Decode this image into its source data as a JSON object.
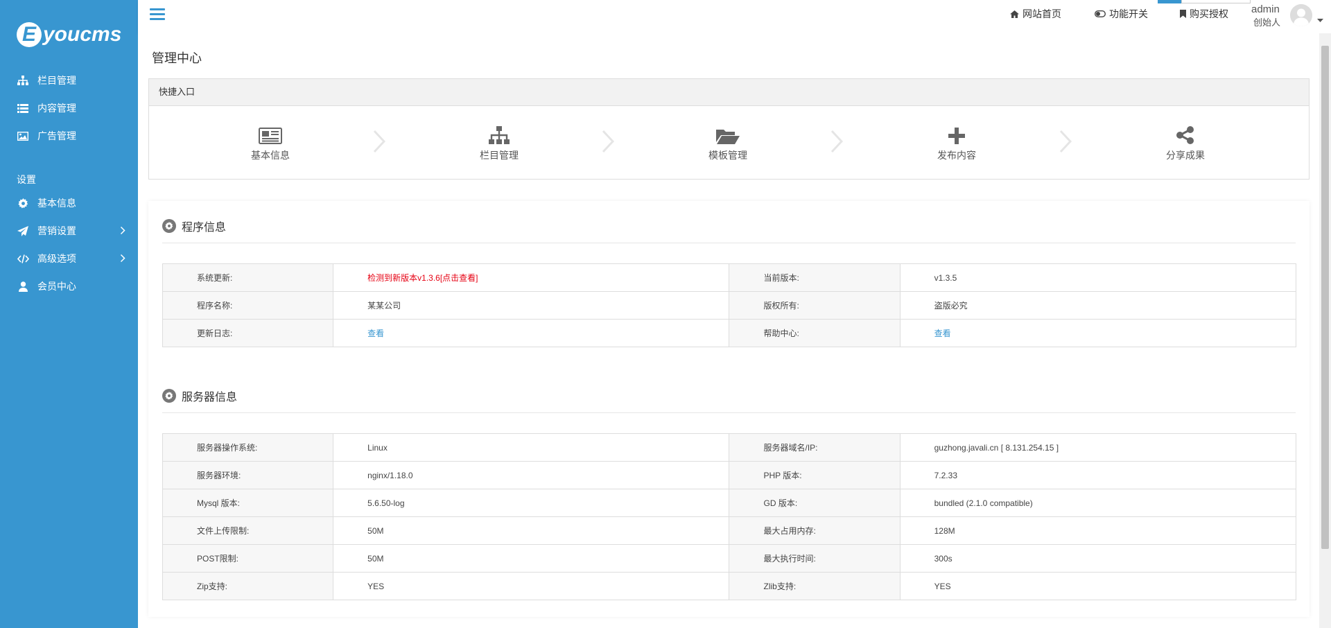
{
  "brand": {
    "logo_letter": "E",
    "logo_text": "youcms"
  },
  "sidebar": {
    "items": [
      {
        "label": "栏目管理",
        "icon": "sitemap-icon"
      },
      {
        "label": "内容管理",
        "icon": "list-icon"
      },
      {
        "label": "广告管理",
        "icon": "image-icon"
      }
    ],
    "section_label": "设置",
    "settings": [
      {
        "label": "基本信息",
        "icon": "gear-icon"
      },
      {
        "label": "营销设置",
        "icon": "paper-plane-icon"
      },
      {
        "label": "高级选项",
        "icon": "code-icon"
      },
      {
        "label": "会员中心",
        "icon": "user-icon"
      }
    ]
  },
  "topbar": {
    "home_label": "网站首页",
    "toggle_label": "功能开关",
    "buy_label": "购买授权",
    "user_name": "admin",
    "user_role": "创始人"
  },
  "main": {
    "page_title": "管理中心",
    "quick_title": "快捷入口",
    "quick_items": [
      {
        "label": "基本信息",
        "icon": "newspaper-icon"
      },
      {
        "label": "栏目管理",
        "icon": "sitemap-icon"
      },
      {
        "label": "模板管理",
        "icon": "folder-open-icon"
      },
      {
        "label": "发布内容",
        "icon": "plus-icon"
      },
      {
        "label": "分享成果",
        "icon": "share-icon"
      }
    ],
    "program_title": "程序信息",
    "program_rows": [
      {
        "k1": "系统更新:",
        "v1": "检测到新版本v1.3.6[点击查看]",
        "k2": "当前版本:",
        "v2": "v1.3.5"
      },
      {
        "k1": "程序名称:",
        "v1": "某某公司",
        "k2": "版权所有:",
        "v2": "盗版必究"
      },
      {
        "k1": "更新日志:",
        "v1": "查看",
        "k2": "帮助中心:",
        "v2": "查看"
      }
    ],
    "server_title": "服务器信息",
    "server_rows": [
      {
        "k1": "服务器操作系统:",
        "v1": "Linux",
        "k2": "服务器域名/IP:",
        "v2": "guzhong.javali.cn [ 8.131.254.15 ]"
      },
      {
        "k1": "服务器环境:",
        "v1": "nginx/1.18.0",
        "k2": "PHP 版本:",
        "v2": "7.2.33"
      },
      {
        "k1": "Mysql 版本:",
        "v1": "5.6.50-log",
        "k2": "GD 版本:",
        "v2": "bundled (2.1.0 compatible)"
      },
      {
        "k1": "文件上传限制:",
        "v1": "50M",
        "k2": "最大占用内存:",
        "v2": "128M"
      },
      {
        "k1": "POST限制:",
        "v1": "50M",
        "k2": "最大执行时间:",
        "v2": "300s"
      },
      {
        "k1": "Zip支持:",
        "v1": "YES",
        "k2": "Zlib支持:",
        "v2": "YES"
      }
    ]
  },
  "colors": {
    "accent": "#3896d0",
    "alert": "#e60012",
    "sidebar_bg": "#3896d0"
  }
}
